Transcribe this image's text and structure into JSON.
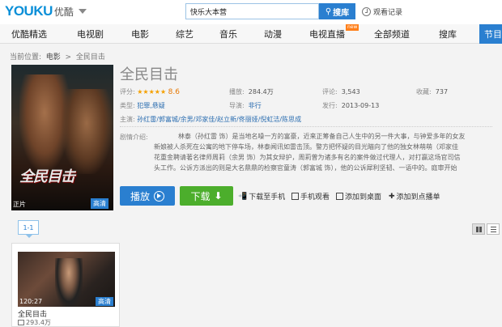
{
  "header": {
    "logo_text_1": "YOUKU",
    "logo_text_2": "优酷",
    "search_value": "快乐大本营",
    "search_button": "搜库",
    "history_label": "观看记录"
  },
  "nav": {
    "items": [
      "优酷精选",
      "电视剧",
      "电影",
      "综艺",
      "音乐",
      "动漫",
      "电视直播",
      "全部频道",
      "搜库",
      "节目"
    ],
    "new_badge": "new",
    "active_index": 9
  },
  "breadcrumb": {
    "prefix": "当前位置:",
    "section": "电影",
    "sep": ">",
    "current": "全民目击"
  },
  "movie": {
    "title": "全民目击",
    "poster_title": "全民目击",
    "poster_tag": "正片",
    "poster_hd": "高清",
    "rating_label": "评分:",
    "stars": "★★★★★",
    "rating": "8.6",
    "plays_label": "播放:",
    "plays": "284.4万",
    "comments_label": "评论:",
    "comments": "3,543",
    "favorites_label": "收藏:",
    "favorites": "737",
    "genre_label": "类型:",
    "genre": "犯罪,悬疑",
    "director_label": "导演:",
    "director": "非行",
    "release_label": "发行:",
    "release": "2013-09-13",
    "cast_label": "主演:",
    "cast": "孙红雷/郭富城/余男/邓家佳/赵立新/佟丽娅/倪虹洁/陈思成",
    "intro_label": "剧情介绍:",
    "intro_lines": [
      "林泰（孙红雷 饰）是当地名噪一方的富豪，近来正筹备自己人生中的另一件大事，与钟爱多年的女友",
      "新娘被人杀死在公寓的地下停车场，林泰闻讯如雷击顶。警方把怀疑的目光瞄向了他的独女林萌萌（邓家佳",
      "花重金聘请著名律师周莉（余男 饰）为其女辩护，周莉曾为诸多有名的案件做过代理人，对打赢这场官司信",
      "头工作。公诉方派出的则是大名鼎鼎的检察官童涛（郭富城 饰），他的公诉犀利坚韧、一语中的。庭审开始"
    ]
  },
  "actions": {
    "play": "播放",
    "download": "下载",
    "download_phone": "下载至手机",
    "phone_watch": "手机观看",
    "add_desktop": "添加到桌面",
    "add_playlist": "添加到点播单"
  },
  "episodes": {
    "tab": "1-1"
  },
  "card": {
    "duration": "120:27",
    "hd": "高清",
    "title": "全民目击",
    "plays": "293.4万"
  }
}
